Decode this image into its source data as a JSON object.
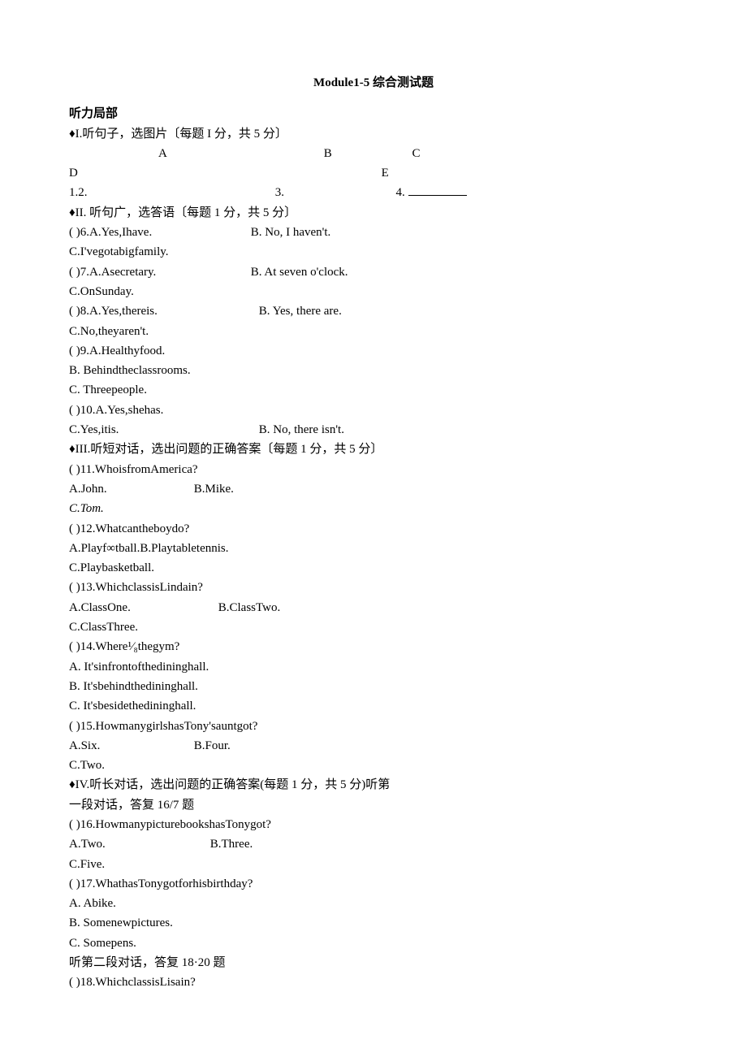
{
  "title": "Module1-5 综合测试题",
  "listening_header": "听力局部",
  "s1": {
    "instr": "♦I.听句子，选图片〔每题 I 分，共 5 分〕",
    "labels": {
      "A": "A",
      "B": "B",
      "C": "C",
      "D": "D",
      "E": "E"
    },
    "nums": {
      "n12": "1.2.",
      "n3": "3.",
      "n4": "4."
    }
  },
  "s2": {
    "instr": "♦II. 听句广，选答语〔每题 1 分，共 5 分〕",
    "q6": {
      "a": "(     )6.A.Yes,Ihave.",
      "b": "B. No, I haven't.",
      "c": "C.I'vegotabigfamily."
    },
    "q7": {
      "a": "(     )7.A.Asecretary.",
      "b": "B. At seven o'clock.",
      "c": "C.OnSunday."
    },
    "q8": {
      "a": "(     )8.A.Yes,thereis.",
      "b": "B. Yes, there are.",
      "c": "C.No,theyaren't."
    },
    "q9": {
      "a": "(     )9.A.Healthyfood.",
      "b": "B.   Behindtheclassrooms.",
      "c": "C.   Threepeople."
    },
    "q10": {
      "a": "(     )10.A.Yes,shehas.",
      "b": "B. No, there isn't.",
      "c": "C.Yes,itis."
    }
  },
  "s3": {
    "instr": "♦III.听短对话，选出问题的正确答案〔每题 1 分，共 5 分〕",
    "q11": {
      "q": "(     )11.WhoisfromAmerica?",
      "a": "A.John.",
      "b": "B.Mike.",
      "c": "C.Tom."
    },
    "q12": {
      "q": "(     )12.Whatcantheboydo?",
      "ab": "A.Playf∞tball.B.Playtabletennis.",
      "c": "C.Playbasketball."
    },
    "q13": {
      "q": "(     )13.WhichclassisLindain?",
      "a": "A.ClassOne.",
      "b": "B.ClassTwo.",
      "c": "C.ClassThree."
    },
    "q14": {
      "q": "(     )14.Where¹⁄₈thegym?",
      "a": "A.   It'sinfrontofthedininghall.",
      "b": "B.   It'sbehindthedininghall.",
      "c": "C.   It'sbesidethedininghall."
    },
    "q15": {
      "q": "(     )15.HowmanygirlshasTony'sauntgot?",
      "a": "A.Six.",
      "b": "B.Four.",
      "c": "C.Two."
    }
  },
  "s4": {
    "instr": "♦IV.听长对话，选出问题的正确答案(每题 1 分，共 5 分)听第一段对话，答复 16/7 题",
    "q16": {
      "q": "(     )16.HowmanypicturebookshasTonygot?",
      "a": "A.Two.",
      "b": "B.Three.",
      "c": "C.Five."
    },
    "q17": {
      "q": "(     )17.WhathasTonygotforhisbirthday?",
      "a": "A.   Abike.",
      "b": "B.   Somenewpictures.",
      "c": "C.   Somepens."
    },
    "d2": "听第二段对话，答复 18·20 题",
    "q18": {
      "q": "(     )18.WhichclassisLisain?"
    }
  }
}
